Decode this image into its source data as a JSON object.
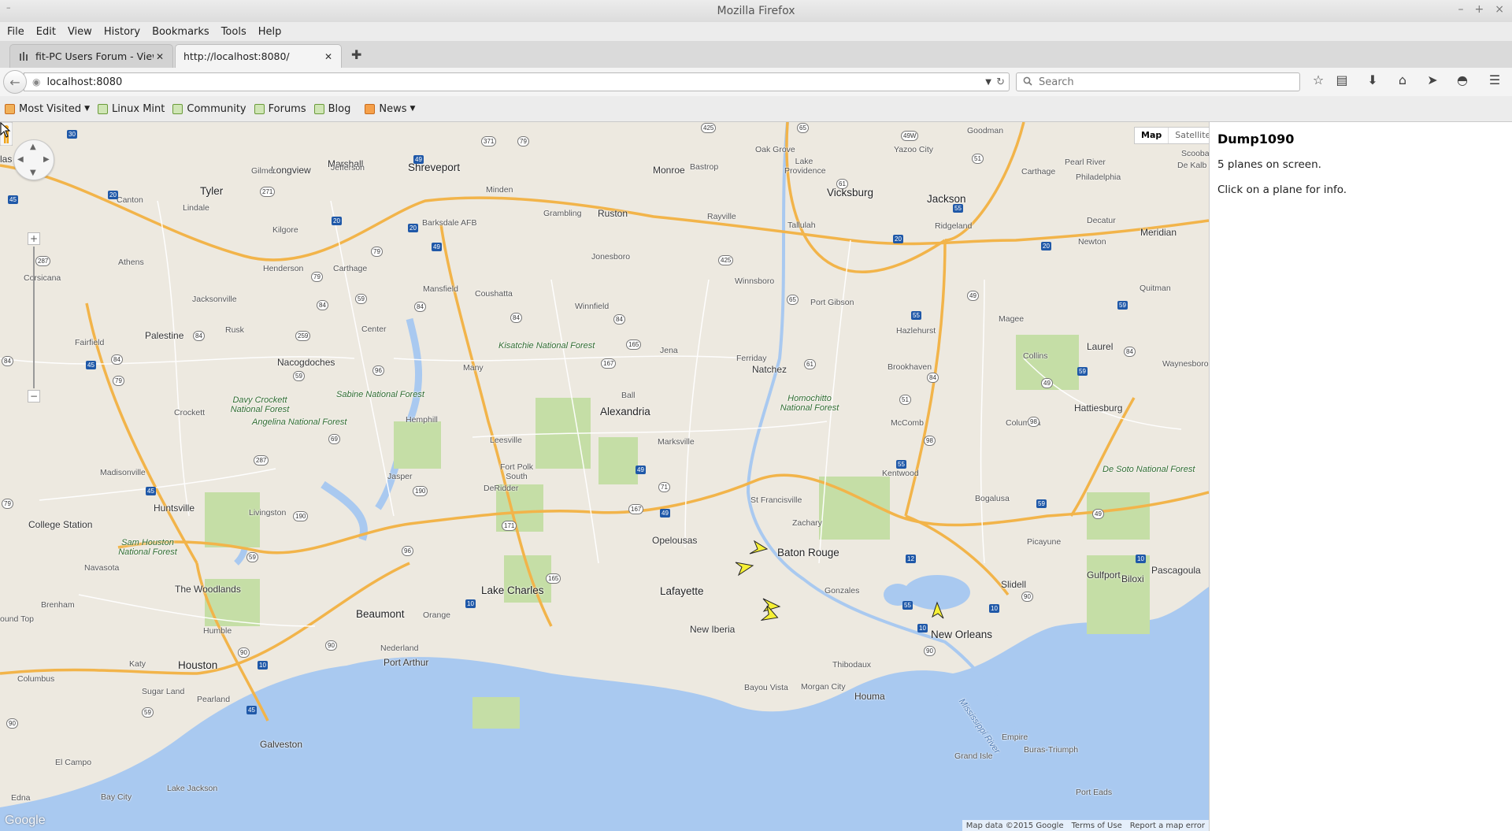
{
  "window": {
    "title": "Mozilla Firefox",
    "sys_menu": "–",
    "controls": [
      "–",
      "+",
      "×"
    ]
  },
  "menubar": [
    "File",
    "Edit",
    "View",
    "History",
    "Bookmarks",
    "Tools",
    "Help"
  ],
  "tabs": [
    {
      "label": "fit-PC Users Forum - View...",
      "active": false
    },
    {
      "label": "http://localhost:8080/",
      "active": true
    }
  ],
  "navbar": {
    "url": "localhost:8080",
    "search_placeholder": "Search"
  },
  "bookmarks": [
    {
      "label": "Most Visited",
      "dropdown": true
    },
    {
      "label": "Linux Mint",
      "dropdown": false
    },
    {
      "label": "Community",
      "dropdown": false
    },
    {
      "label": "Forums",
      "dropdown": false
    },
    {
      "label": "Blog",
      "dropdown": false
    },
    {
      "label": "News",
      "dropdown": true
    }
  ],
  "map": {
    "type_buttons": {
      "map": "Map",
      "satellite": "Satellite"
    },
    "footer": {
      "attribution": "Map data ©2015 Google",
      "terms": "Terms of Use",
      "report": "Report a map error"
    },
    "logo": "Google",
    "colors": {
      "land": "#ede9e0",
      "water": "#a9c9f0",
      "forest": "#c5dea6",
      "highway": "#f2b44a",
      "road": "#ffffff"
    },
    "labels": {
      "shreveport": "Shreveport",
      "monroe": "Monroe",
      "vicksburg": "Vicksburg",
      "jackson": "Jackson",
      "tyler": "Tyler",
      "longview": "Longview",
      "marshall": "Marshall",
      "alexandria": "Alexandria",
      "natchez": "Natchez",
      "hattiesburg": "Hattiesburg",
      "baton_rouge": "Baton Rouge",
      "lafayette": "Lafayette",
      "lake_charles": "Lake Charles",
      "beaumont": "Beaumont",
      "houston": "Houston",
      "new_orleans": "New Orleans",
      "gulfport": "Gulfport",
      "biloxi": "Biloxi",
      "pascagoula": "Pascagoula",
      "huntsville": "Huntsville",
      "college_station": "College Station",
      "the_woodlands": "The Woodlands",
      "nacogdoches": "Nacogdoches",
      "palestine": "Palestine",
      "ruston": "Ruston",
      "laurel": "Laurel",
      "meridian": "Meridian",
      "galveston": "Galveston",
      "port_arthur": "Port Arthur",
      "houma": "Houma",
      "thibodaux": "Thibodaux",
      "new_iberia": "New Iberia",
      "opelousas": "Opelousas",
      "slidell": "Slidell",
      "mccomb": "McComb",
      "brookhaven": "Brookhaven",
      "picayune": "Picayune",
      "bogalusa": "Bogalusa",
      "kentwood": "Kentwood",
      "zachary": "Zachary",
      "st_francisville": "St Francisville",
      "minden": "Minden",
      "bastrop": "Bastrop",
      "yazoo_city": "Yazoo City",
      "tallulah": "Tallulah",
      "winnfield": "Winnfield",
      "jena": "Jena",
      "natchitoches_forest": "Kisatchie National Forest",
      "sabine_forest": "Sabine National Forest",
      "homochitto": "Homochitto National Forest",
      "desoto": "De Soto National Forest",
      "davy_crockett": "Davy Crockett National Forest",
      "angelina": "Angelina National Forest",
      "sam_houston": "Sam Houston National Forest",
      "corsicana": "Corsicana",
      "athens": "Athens",
      "jacksonville": "Jacksonville",
      "lufkin_area": "Crockett",
      "canton": "Canton",
      "gilmer": "Gilmer",
      "jefferson": "Jefferson",
      "carthage": "Carthage",
      "henderson": "Henderson",
      "mansfield": "Mansfield",
      "many": "Many",
      "leesville": "Leesville",
      "deridder": "DeRidder",
      "jasper": "Jasper",
      "hemphill": "Hemphill",
      "livingston": "Livingston",
      "navasota": "Navasota",
      "brenham": "Brenham",
      "humble": "Humble",
      "katy": "Katy",
      "sugar_land": "Sugar Land",
      "pearland": "Pearland",
      "orange": "Orange",
      "nederland": "Nederland",
      "fort_polk": "Fort Polk South",
      "ball": "Ball",
      "marksville": "Marksville",
      "ferriday": "Ferriday",
      "port_gibson": "Port Gibson",
      "ridgeland": "Ridgeland",
      "philadelphia": "Philadelphia",
      "magee": "Magee",
      "columbia": "Columbia",
      "collins": "Collins",
      "hazlehurst": "Hazlehurst",
      "morgan_city": "Morgan City",
      "bayou_vista": "Bayou Vista",
      "gonzales": "Gonzales",
      "grand_isle": "Grand Isle",
      "empire": "Empire",
      "buras": "Buras-Triumph",
      "port_eads": "Port Eads",
      "miss_river": "Mississippi River",
      "el_campo": "El Campo",
      "bay_city": "Bay City",
      "lake_jackson": "Lake Jackson",
      "edna": "Edna",
      "columbus": "Columbus",
      "oak_grove": "Oak Grove",
      "lake_providence": "Lake Providence",
      "rayville": "Rayville",
      "winnsboro": "Winnsboro",
      "jonesboro": "Jonesboro",
      "grambling": "Grambling",
      "coushatta": "Coushatta",
      "barksdale": "Barksdale AFB",
      "kilgore": "Kilgore",
      "lindale": "Lindale",
      "fairfield": "Fairfield",
      "madisonville": "Madisonville",
      "rusk": "Rusk",
      "center": "Center",
      "pearl_river": "Pearl River",
      "carthage_ms": "Carthage",
      "decatur": "Decatur",
      "newton": "Newton",
      "quitman": "Quitman",
      "waynesboro": "Waynesboro",
      "goodman": "Goodman",
      "scooba": "Scooba",
      "de_kalb": "De Kalb",
      "las": "las",
      "ound_top": "ound Top",
      "edna2": "Edna"
    }
  },
  "sidebar": {
    "name": "Dump1090",
    "planes_text": "5 planes on screen.",
    "hint": "Click on a plane for info."
  },
  "planes_on_screen": 5
}
